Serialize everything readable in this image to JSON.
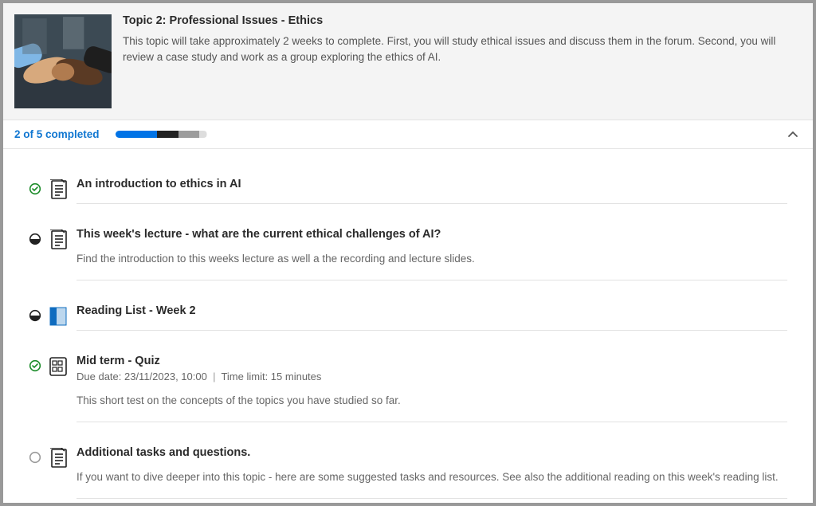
{
  "header": {
    "title": "Topic 2: Professional Issues - Ethics",
    "description": "This topic will take approximately 2 weeks to complete. First, you will study ethical issues and discuss them in the forum. Second, you will review a case study and work as a group exploring the ethics of AI."
  },
  "progress": {
    "label": "2 of 5 completed",
    "completed": 2,
    "total": 5
  },
  "items": [
    {
      "status": "complete",
      "icon": "page",
      "title": "An introduction to ethics in AI",
      "meta": "",
      "desc": ""
    },
    {
      "status": "inprogress",
      "icon": "page",
      "title": "This week's lecture - what are the current ethical challenges of AI?",
      "meta": "",
      "desc": "Find the introduction to this weeks lecture as well a the recording and lecture slides."
    },
    {
      "status": "inprogress",
      "icon": "book",
      "title": "Reading List - Week 2",
      "meta": "",
      "desc": ""
    },
    {
      "status": "complete",
      "icon": "quiz",
      "title": "Mid term - Quiz",
      "meta_due": "Due date: 23/11/2023, 10:00",
      "meta_limit": "Time limit: 15 minutes",
      "desc": "This short test on the concepts of the topics you have studied so far."
    },
    {
      "status": "notstarted",
      "icon": "page",
      "title": "Additional tasks and questions.",
      "meta": "",
      "desc": "If you want to dive deeper into this topic - here are some suggested tasks and resources. See also the additional reading on this week's reading list."
    }
  ]
}
